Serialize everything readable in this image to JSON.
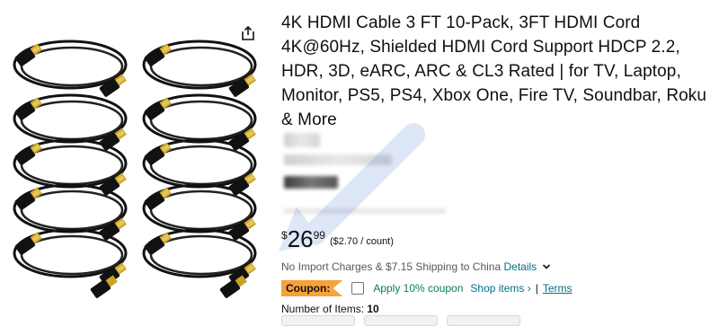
{
  "product": {
    "title": "4K HDMI Cable 3 FT 10-Pack, 3FT HDMI Cord 4K@60Hz, Shielded HDMI Cord Support HDCP 2.2, HDR, 3D, eARC, ARC & CL3 Rated | for TV, Laptop, Monitor, PS5, PS4, Xbox One, Fire TV, Soundbar, Roku & More",
    "image_icon": "hdmi-cables-10-pack-image",
    "share_icon": "share-icon"
  },
  "price": {
    "symbol": "$",
    "whole": "26",
    "fraction": "99",
    "per_unit": "($2.70 / count)"
  },
  "shipping": {
    "text": "No Import Charges & $7.15 Shipping to China",
    "details_label": "Details",
    "chevron_icon": "chevron-down-icon"
  },
  "coupon": {
    "badge": "Coupon:",
    "apply_text": "Apply 10% coupon",
    "shop_items": "Shop items ›",
    "separator": "|",
    "terms": "Terms"
  },
  "items": {
    "label": "Number of Items:",
    "value": "10"
  },
  "colors": {
    "link": "#007185",
    "coupon_green": "#067d62",
    "coupon_badge": "#f7a23a",
    "text": "#0f1111",
    "secondary": "#565959"
  }
}
